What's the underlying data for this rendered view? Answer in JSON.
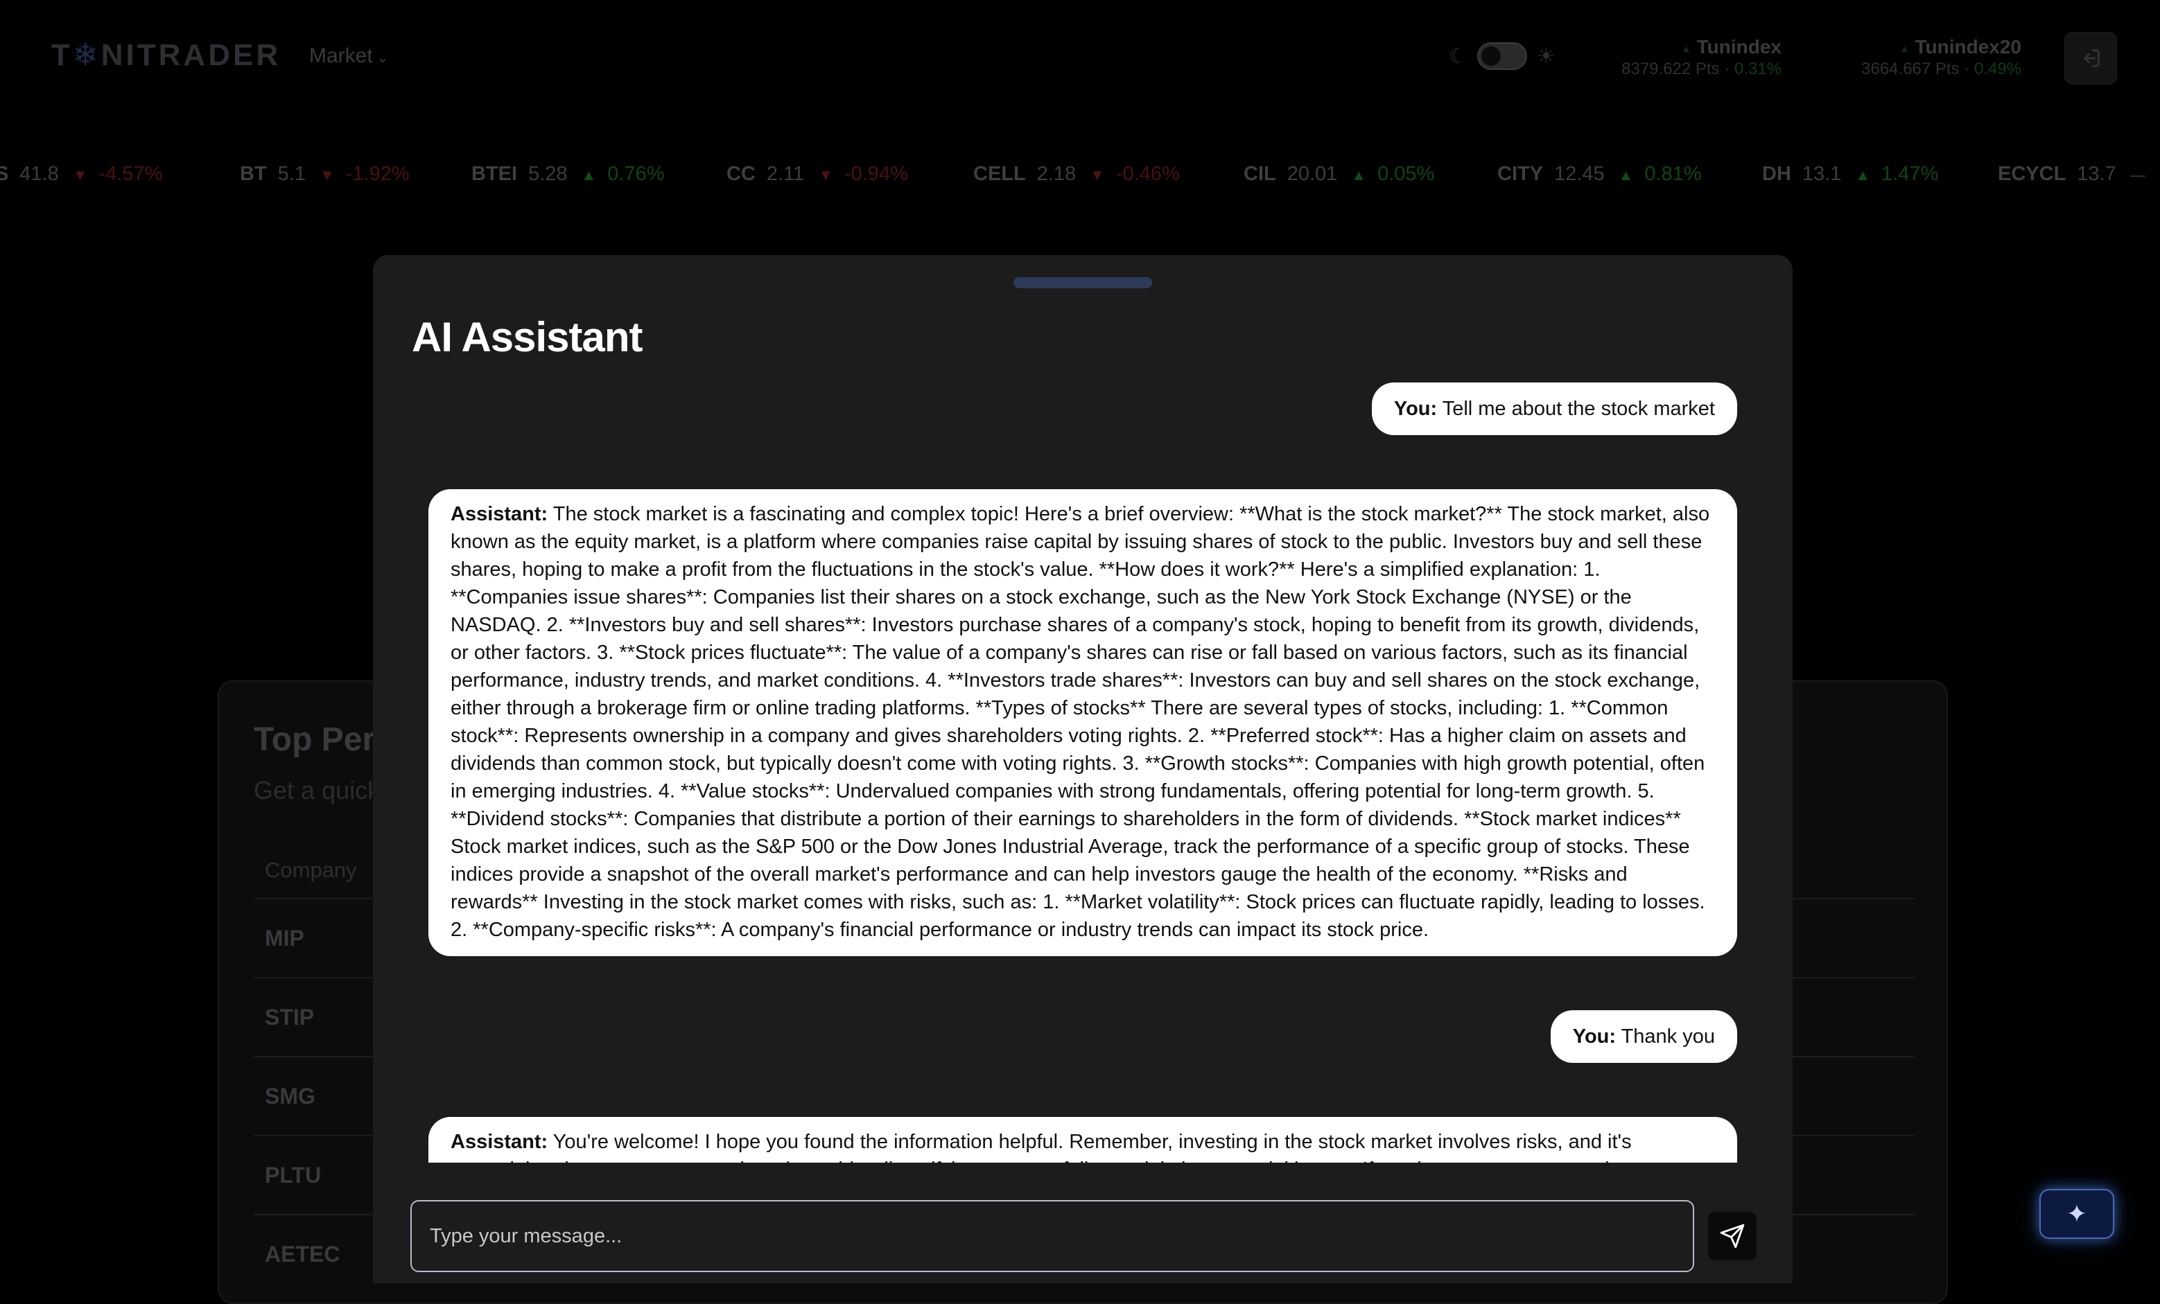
{
  "header": {
    "logo_text": "TUNITRADER",
    "logo_part1": "T",
    "logo_part2": "NITRADER",
    "market_menu_label": "Market",
    "indices": [
      {
        "name": "Tunindex",
        "points": "8379.622 Pts",
        "change": "0.31%"
      },
      {
        "name": "Tunindex20",
        "points": "3664.667 Pts",
        "change": "0.49%"
      }
    ],
    "separator": "·"
  },
  "ticker": [
    {
      "symbol": "BS",
      "price": "41.8",
      "direction": "down",
      "change": "-4.57%"
    },
    {
      "symbol": "BT",
      "price": "5.1",
      "direction": "down",
      "change": "-1.92%"
    },
    {
      "symbol": "BTEI",
      "price": "5.28",
      "direction": "up",
      "change": "0.76%"
    },
    {
      "symbol": "CC",
      "price": "2.11",
      "direction": "down",
      "change": "-0.94%"
    },
    {
      "symbol": "CELL",
      "price": "2.18",
      "direction": "down",
      "change": "-0.46%"
    },
    {
      "symbol": "CIL",
      "price": "20.01",
      "direction": "up",
      "change": "0.05%"
    },
    {
      "symbol": "CITY",
      "price": "12.45",
      "direction": "up",
      "change": "0.81%"
    },
    {
      "symbol": "DH",
      "price": "13.1",
      "direction": "up",
      "change": "1.47%"
    },
    {
      "symbol": "ECYCL",
      "price": "13.7",
      "direction": "flat",
      "change": ""
    }
  ],
  "background_card": {
    "title": "Top Perfo",
    "subtitle": "Get a quick",
    "column_header": "Company",
    "rows": [
      "MIP",
      "STIP",
      "SMG",
      "PLTU",
      "AETEC"
    ]
  },
  "modal": {
    "title": "AI Assistant",
    "messages": [
      {
        "role": "user",
        "speaker": "You:",
        "text": "Tell me about the stock market"
      },
      {
        "role": "assistant",
        "speaker": "Assistant:",
        "text": "The stock market is a fascinating and complex topic! Here's a brief overview: **What is the stock market?** The stock market, also known as the equity market, is a platform where companies raise capital by issuing shares of stock to the public. Investors buy and sell these shares, hoping to make a profit from the fluctuations in the stock's value. **How does it work?** Here's a simplified explanation: 1. **Companies issue shares**: Companies list their shares on a stock exchange, such as the New York Stock Exchange (NYSE) or the NASDAQ. 2. **Investors buy and sell shares**: Investors purchase shares of a company's stock, hoping to benefit from its growth, dividends, or other factors. 3. **Stock prices fluctuate**: The value of a company's shares can rise or fall based on various factors, such as its financial performance, industry trends, and market conditions. 4. **Investors trade shares**: Investors can buy and sell shares on the stock exchange, either through a brokerage firm or online trading platforms. **Types of stocks** There are several types of stocks, including: 1. **Common stock**: Represents ownership in a company and gives shareholders voting rights. 2. **Preferred stock**: Has a higher claim on assets and dividends than common stock, but typically doesn't come with voting rights. 3. **Growth stocks**: Companies with high growth potential, often in emerging industries. 4. **Value stocks**: Undervalued companies with strong fundamentals, offering potential for long-term growth. 5. **Dividend stocks**: Companies that distribute a portion of their earnings to shareholders in the form of dividends. **Stock market indices** Stock market indices, such as the S&P 500 or the Dow Jones Industrial Average, track the performance of a specific group of stocks. These indices provide a snapshot of the overall market's performance and can help investors gauge the health of the economy. **Risks and rewards** Investing in the stock market comes with risks, such as: 1. **Market volatility**: Stock prices can fluctuate rapidly, leading to losses. 2. **Company-specific risks**: A company's financial performance or industry trends can impact its stock price."
      },
      {
        "role": "user",
        "speaker": "You:",
        "text": "Thank you"
      },
      {
        "role": "assistant",
        "speaker": "Assistant:",
        "text": "You're welcome! I hope you found the information helpful. Remember, investing in the stock market involves risks, and it's essential to do your own research and consider diversifying your portfolio to minimize potential losses. If you have any more questions or need"
      }
    ],
    "input_placeholder": "Type your message..."
  },
  "icons": {
    "theme_moon": "moon-icon",
    "theme_sun": "sun-icon",
    "logout": "logout-icon",
    "send": "send-icon",
    "assistant_fab": "sparkle-icon"
  },
  "colors": {
    "modal_bg": "#1c1c1c",
    "bubble_bg": "#ffffff",
    "positive": "#16a34a",
    "negative": "#dc2626",
    "fab_glow": "#3b82f6"
  }
}
